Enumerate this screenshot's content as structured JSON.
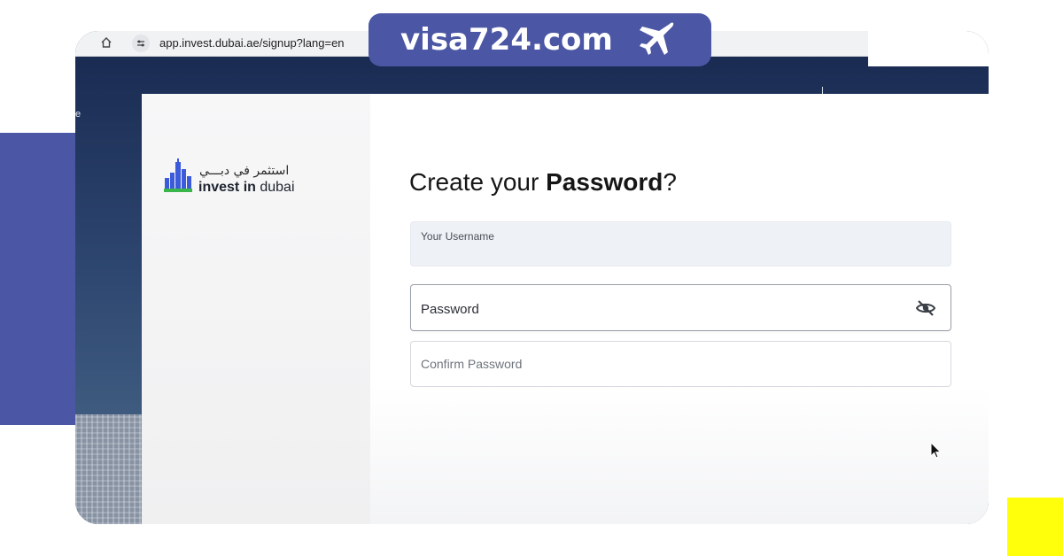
{
  "browser": {
    "url": "app.invest.dubai.ae/signup?lang=en"
  },
  "background": {
    "edge_text": "e"
  },
  "logo": {
    "arabic": "استثمر في دبـــي",
    "english_bold": "invest in",
    "english_regular": " dubai"
  },
  "form": {
    "heading_regular": "Create your ",
    "heading_bold": "Password",
    "heading_suffix": "?",
    "username_label": "Your Username",
    "password_label": "Password",
    "confirm_label": "Confirm Password"
  },
  "watermark": {
    "text": "visa724.com"
  },
  "icons": {
    "home": "home-icon",
    "site_settings": "site-settings-icon",
    "password_visibility": "eye-slash-icon",
    "cursor": "mouse-pointer-icon",
    "plane": "airplane-icon"
  },
  "colors": {
    "brand_blue": "#4b56a4",
    "accent_yellow": "#ffff0c",
    "logo_blue": "#3b5bdb",
    "logo_green": "#39b54a"
  }
}
